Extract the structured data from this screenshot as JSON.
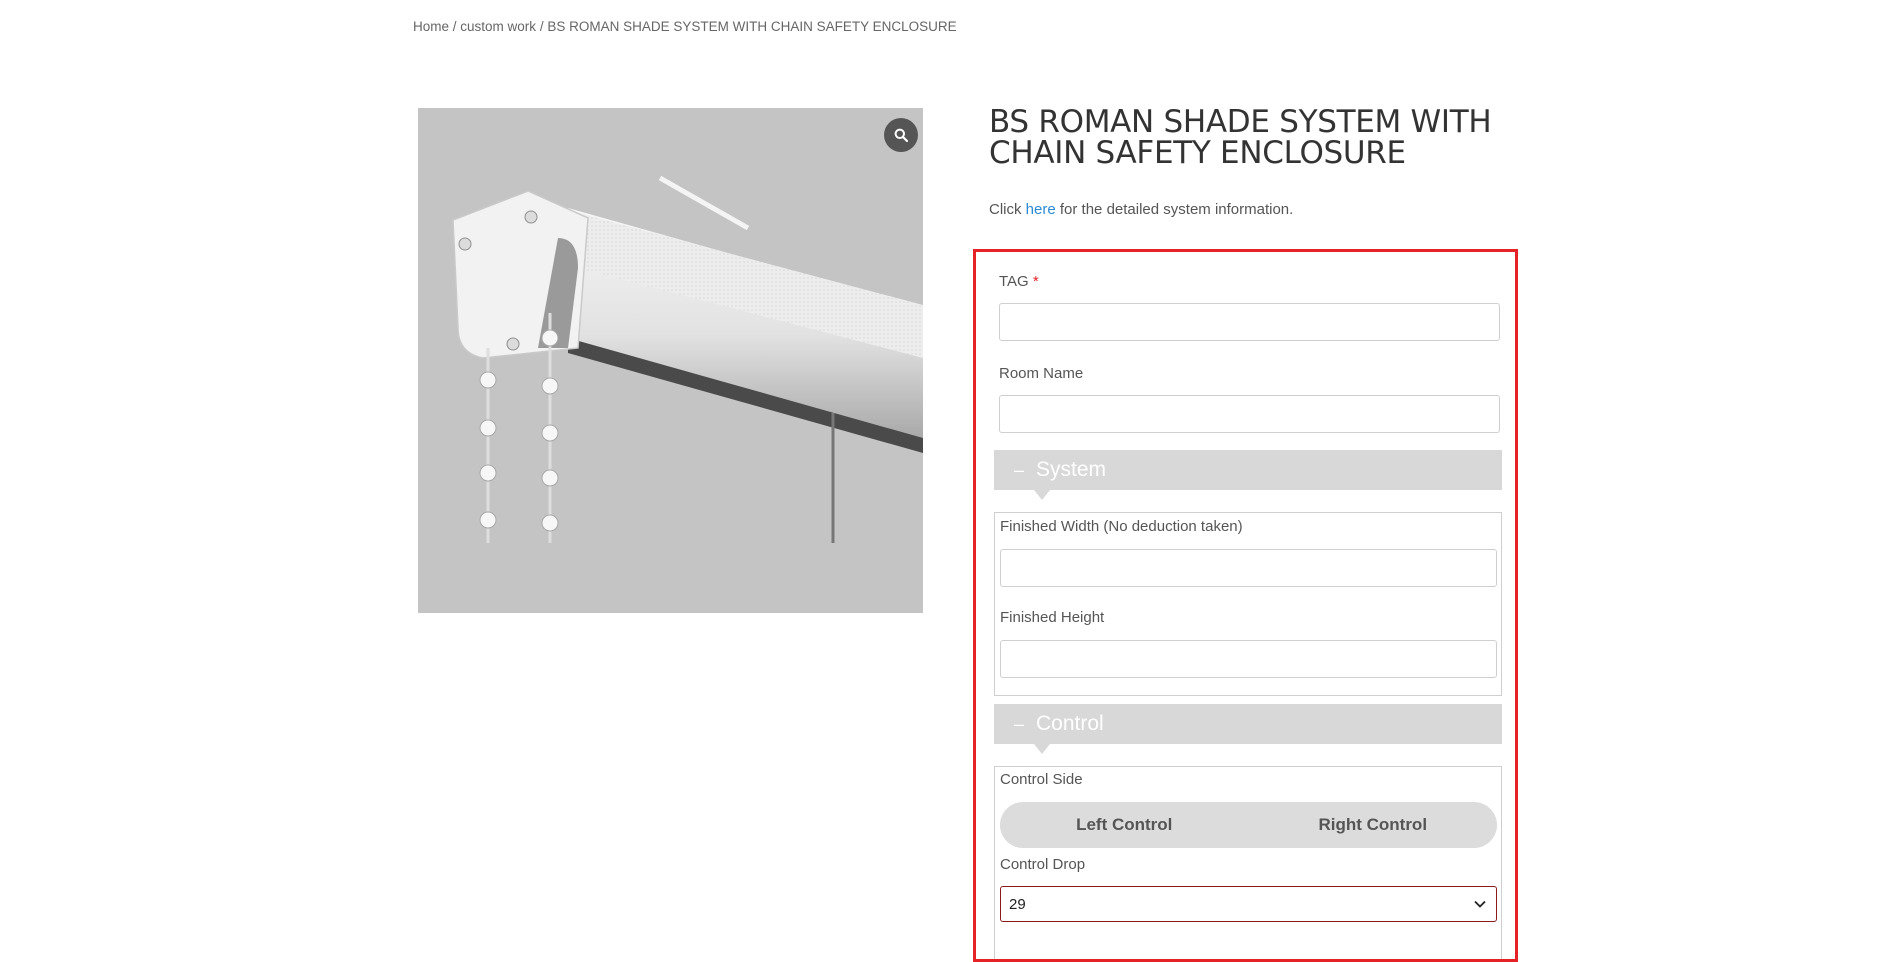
{
  "breadcrumb": {
    "home": "Home",
    "sep1": " / ",
    "category": "custom work",
    "sep2": " / ",
    "current": "BS ROMAN SHADE SYSTEM WITH CHAIN SAFETY ENCLOSURE"
  },
  "product": {
    "title": "BS ROMAN SHADE SYSTEM WITH CHAIN SAFETY ENCLOSURE",
    "info_prefix": "Click ",
    "info_link": "here",
    "info_suffix": " for the detailed system information.",
    "zoom_icon": "magnifier-icon"
  },
  "form": {
    "tag_label": "TAG",
    "tag_required_mark": "*",
    "tag_value": "",
    "room_label": "Room Name",
    "room_value": "",
    "system_section": {
      "toggle": "–",
      "title": "System",
      "width_label": "Finished Width (No deduction taken)",
      "width_value": "",
      "height_label": "Finished Height",
      "height_value": ""
    },
    "control_section": {
      "toggle": "–",
      "title": "Control",
      "side_label": "Control Side",
      "side_options": [
        "Left Control",
        "Right Control"
      ],
      "drop_label": "Control Drop",
      "drop_value": "29"
    }
  },
  "colors": {
    "highlight_border": "#e52225",
    "link": "#2a8ad4",
    "section_bar": "#d8d8d8",
    "image_background": "#c4c4c4"
  }
}
